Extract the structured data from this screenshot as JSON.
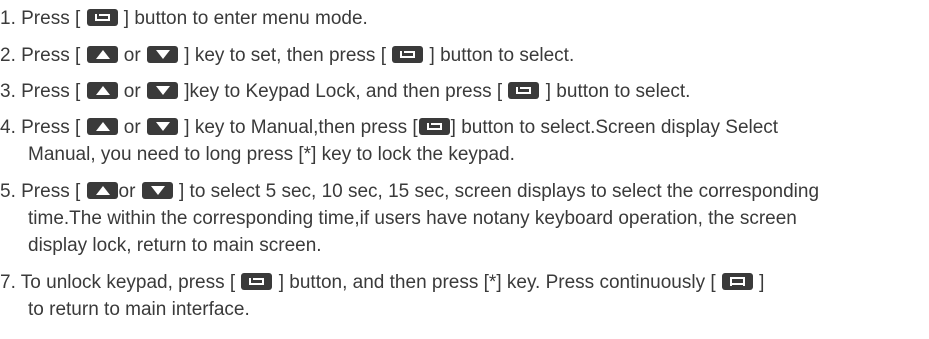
{
  "icons": {
    "menu": "menu-button-icon",
    "up": "up-arrow-key-icon",
    "down": "down-arrow-key-icon",
    "menu_alt": "menu-alt-button-icon"
  },
  "steps": {
    "s1": {
      "a": "1. Press [ ",
      "b": " ] button to enter menu mode."
    },
    "s2": {
      "a": "2. Press [ ",
      "b": " or ",
      "c": " ] key to set, then press [ ",
      "d": " ] button to select."
    },
    "s3": {
      "a": "3. Press [ ",
      "b": " or ",
      "c": " ]key to Keypad Lock, and then press [ ",
      "d": " ] button to select."
    },
    "s4": {
      "a": "4. Press [ ",
      "b": " or ",
      "c": " ] key to Manual,then press [",
      "d": "] button to select.Screen display Select",
      "e": "Manual, you need to long press [*] key to lock the keypad."
    },
    "s5": {
      "a": "5. Press [ ",
      "b": "or ",
      "c": " ] to select 5 sec, 10 sec, 15 sec, screen displays to select the corresponding",
      "d": "time.The within the corresponding time,if users have notany keyboard operation, the screen",
      "e": "display lock, return to main screen."
    },
    "s7": {
      "a": "7. To unlock keypad, press [ ",
      "b": " ] button, and then press [*] key. Press continuously [ ",
      "c": " ]",
      "d": "to return to main interface."
    }
  }
}
